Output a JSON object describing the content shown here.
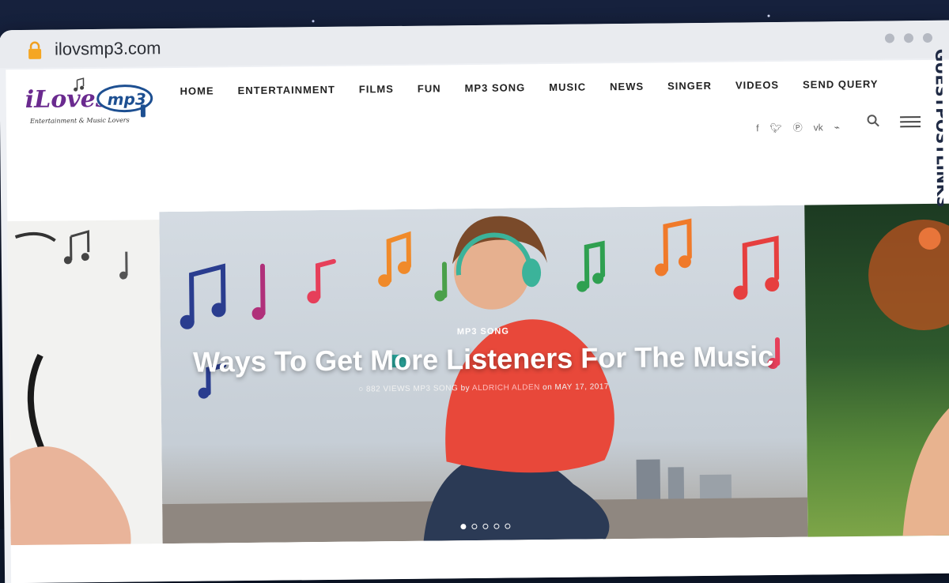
{
  "browser": {
    "url": "ilovsmp3.com"
  },
  "site": {
    "logo_text": "iLoves.mp3",
    "logo_tagline": "Entertainment & Music Lovers"
  },
  "nav": {
    "items": [
      {
        "label": "HOME"
      },
      {
        "label": "ENTERTAINMENT"
      },
      {
        "label": "FILMS"
      },
      {
        "label": "FUN"
      },
      {
        "label": "MP3 SONG"
      },
      {
        "label": "MUSIC"
      },
      {
        "label": "NEWS"
      },
      {
        "label": "SINGER"
      },
      {
        "label": "VIDEOS"
      },
      {
        "label": "SEND QUERY"
      }
    ]
  },
  "social": {
    "icons": [
      "facebook-icon",
      "twitter-icon",
      "pinterest-icon",
      "vk-icon",
      "rss-icon"
    ]
  },
  "hero": {
    "category": "MP3 SONG",
    "title": "Ways To Get More Listeners For The Music",
    "views": "882 VIEWS",
    "meta_category": "MP3 SONG",
    "by": "by",
    "author": "ALDRICH ALDEN",
    "on": "on",
    "date": "MAY 17, 2017",
    "slides_total": 5,
    "active_slide": 1
  },
  "watermark": {
    "text": "GUESTPOSTLINKS"
  },
  "colors": {
    "accent": "#e53950",
    "dark": "#222222"
  }
}
